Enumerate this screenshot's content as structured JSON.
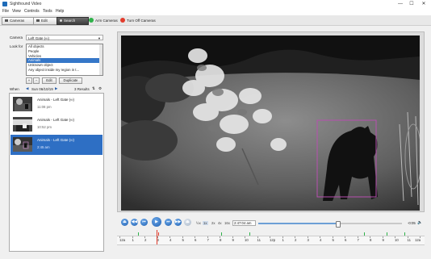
{
  "window": {
    "title": "Sighthound Video",
    "minimize": "—",
    "maximize": "☐",
    "close": "✕"
  },
  "menu": [
    "File",
    "View",
    "Controls",
    "Tools",
    "Help"
  ],
  "toolbar": {
    "cameras": "Cameras",
    "edit": "Edit",
    "search": "Search",
    "arm": "Arm Cameras",
    "turn_off": "Turn Off Cameras",
    "arm_color": "#2fb24a",
    "off_color": "#e23c2c"
  },
  "search_panel": {
    "camera_label": "Camera",
    "camera_value": "Left Gate (∞)",
    "lookfor_label": "Look for",
    "lookfor_options": [
      "All objects",
      "People",
      "Vehicles",
      "Animals",
      "Unknown object",
      "Any object inside my region in t..."
    ],
    "lookfor_selected": 3,
    "add": "+",
    "remove": "−",
    "edit": "Edit",
    "duplicate": "Duplicate",
    "when_label": "When",
    "date": "Sun 06/10/19",
    "results_count": "3 Results"
  },
  "results": [
    {
      "title": "Animals - Left Gate (∞)",
      "time": "11:08 pm"
    },
    {
      "title": "Animals - Left Gate (∞)",
      "time": "10:52 pm"
    },
    {
      "title": "Animals - Left Gate (∞)",
      "time": "2:45 am"
    }
  ],
  "selected_result": 2,
  "playback": {
    "speeds": [
      "½x",
      "1x",
      "2x",
      "4x",
      "16x"
    ],
    "current_time": "2:47:04 am",
    "end_offset": "-0:05",
    "progress": 0.55
  },
  "timeline": {
    "ticks": [
      "12a",
      "1",
      "2",
      "3",
      "4",
      "5",
      "6",
      "7",
      "8",
      "9",
      "10",
      "11",
      "12p",
      "1",
      "2",
      "3",
      "4",
      "5",
      "6",
      "7",
      "8",
      "9",
      "10",
      "11",
      "12a"
    ]
  }
}
